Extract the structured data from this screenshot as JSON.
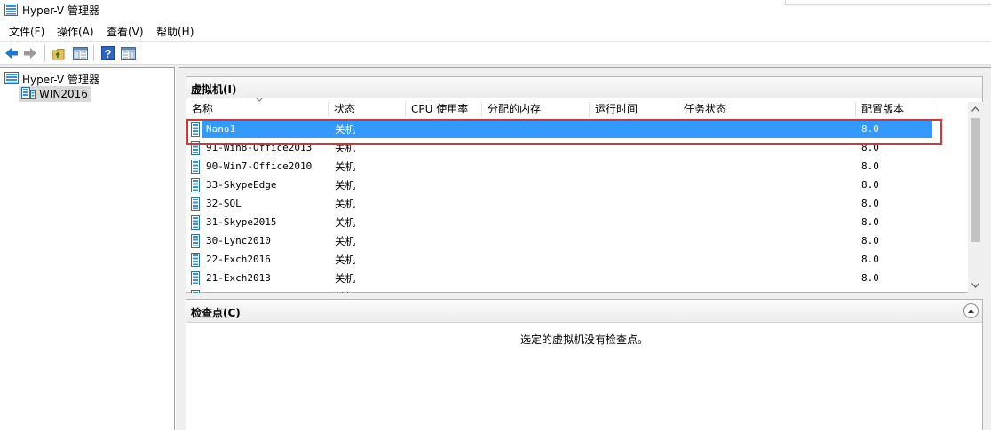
{
  "window": {
    "title": "Hyper-V 管理器"
  },
  "menu": [
    "文件(F)",
    "操作(A)",
    "查看(V)",
    "帮助(H)"
  ],
  "tree": {
    "root": "Hyper-V 管理器",
    "server": "WIN2016"
  },
  "vm_panel": {
    "title": "虚拟机(I)",
    "columns": [
      "名称",
      "状态",
      "CPU 使用率",
      "分配的内存",
      "运行时间",
      "任务状态",
      "配置版本"
    ],
    "rows": [
      {
        "name": "Nano1",
        "state": "关机",
        "version": "8.0",
        "selected": true
      },
      {
        "name": "91-Win8-Office2013",
        "state": "关机",
        "version": "8.0"
      },
      {
        "name": "90-Win7-Office2010",
        "state": "关机",
        "version": "8.0"
      },
      {
        "name": "33-SkypeEdge",
        "state": "关机",
        "version": "8.0"
      },
      {
        "name": "32-SQL",
        "state": "关机",
        "version": "8.0"
      },
      {
        "name": "31-Skype2015",
        "state": "关机",
        "version": "8.0"
      },
      {
        "name": "30-Lync2010",
        "state": "关机",
        "version": "8.0"
      },
      {
        "name": "22-Exch2016",
        "state": "关机",
        "version": "8.0"
      },
      {
        "name": "21-Exch2013",
        "state": "关机",
        "version": "8.0"
      },
      {
        "name": "",
        "state": "关机",
        "version": ""
      }
    ]
  },
  "checkpoint_panel": {
    "title": "检查点(C)",
    "empty_message": "选定的虚拟机没有检查点。"
  },
  "colors": {
    "selection": "#3399ff",
    "highlight_box": "#e0322c",
    "back_arrow": "#1e78d2"
  }
}
